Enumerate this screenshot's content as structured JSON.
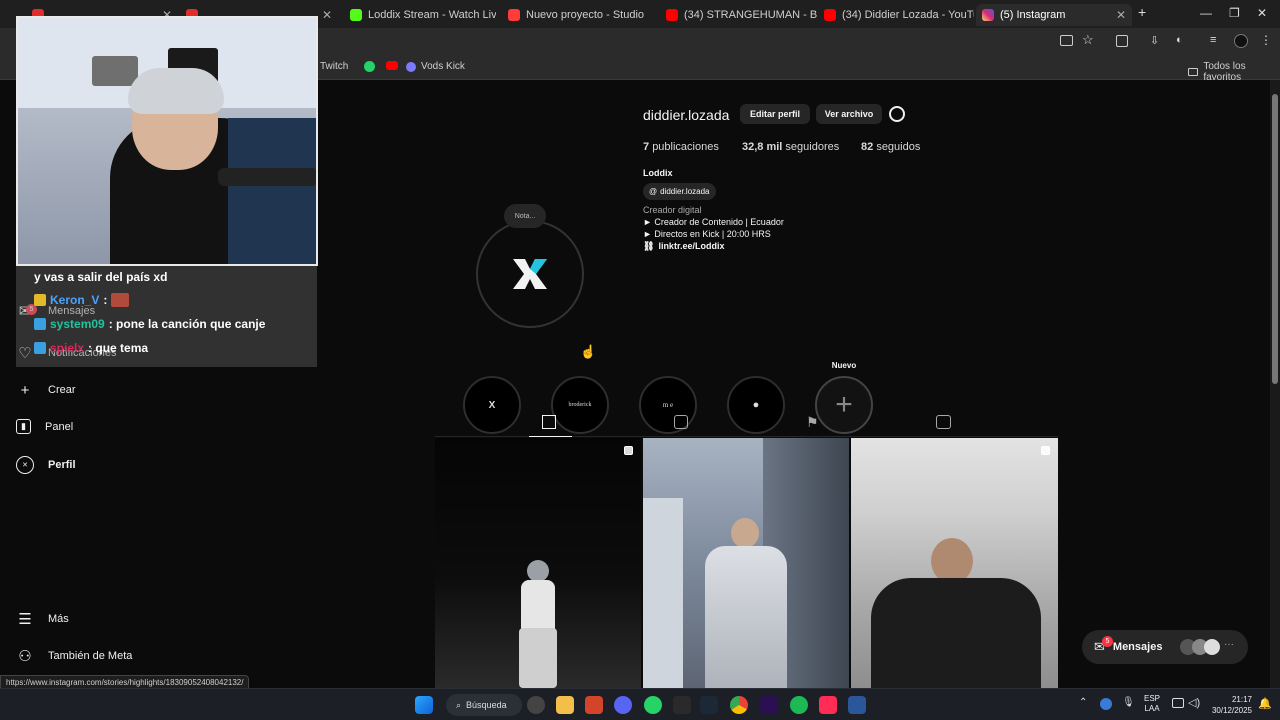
{
  "tabs": [
    {
      "label": "",
      "favicon_color": "#e22b2b",
      "active": false
    },
    {
      "label": "",
      "favicon_color": "#e22b2b",
      "active": false
    },
    {
      "label": "Loddix Stream - Watch Live on",
      "favicon_color": "#53fc18",
      "active": false
    },
    {
      "label": "Nuevo proyecto - Studio",
      "favicon_color": "#ff3b3b",
      "active": false
    },
    {
      "label": "",
      "favicon_color": "#ff5a4e",
      "active": false
    },
    {
      "label": "(34) STRANGEHUMAN - BETTY",
      "favicon_color": "#ff0000",
      "active": false
    },
    {
      "label": "(34) Diddier Lozada - YouTube",
      "favicon_color": "#ff0000",
      "active": false
    },
    {
      "label": "(5) Instagram",
      "favicon_color": "#d6249f",
      "active": true
    }
  ],
  "bookmarks": [
    {
      "label": "Twitch",
      "color": "#9146ff"
    },
    {
      "label": "",
      "color": "#25d366"
    },
    {
      "label": "",
      "color": "#ff0000"
    },
    {
      "label": "Vods Kick",
      "color": "#7b7bff"
    }
  ],
  "bookmarks_folder": "Todos los favoritos",
  "sidebar": {
    "items": [
      {
        "label": "Crear",
        "icon": "plus-icon"
      },
      {
        "label": "Panel",
        "icon": "chart-icon"
      },
      {
        "label": "Perfil",
        "icon": "avatar-icon"
      },
      {
        "label": "Más",
        "icon": "menu-icon"
      },
      {
        "label": "También de Meta",
        "icon": "meta-icon"
      }
    ],
    "mensajes": "Mensajes",
    "mensajes_badge": "5",
    "notificaciones": "Notificaciones"
  },
  "profile": {
    "username": "diddier.lozada",
    "edit_button": "Editar perfil",
    "archive_button": "Ver archivo",
    "posts_count": "7",
    "posts_label": "publicaciones",
    "followers_count": "32,8 mil",
    "followers_label": "seguidores",
    "following_count": "82",
    "following_label": "seguidos",
    "name": "Loddix",
    "threads_handle": "diddier.lozada",
    "category": "Creador digital",
    "bio_line1": "► Creador de Contenido | Ecuador",
    "bio_line2": "► Directos en Kick | 20:00 HRS",
    "link": "linktr.ee/Loddix",
    "note": "Nota..."
  },
  "highlights": [
    {
      "label": "",
      "text": "X"
    },
    {
      "label": "",
      "text": "broderick"
    },
    {
      "label": "",
      "text": "m e"
    },
    {
      "label": "",
      "text": ""
    },
    {
      "label": "Nuevo",
      "text": "+"
    }
  ],
  "profile_tabs": [
    "grid-icon",
    "reels-icon",
    "saved-icon",
    "tagged-icon"
  ],
  "chat_overlay": [
    {
      "user": "",
      "message": "y vas a salir del país xd",
      "user_color": "#ffffff"
    },
    {
      "user": "Keron_V",
      "message": ":",
      "user_color": "#4aa3ff"
    },
    {
      "user": "system09",
      "message": ": pone la canción que canje",
      "user_color": "#1ec4a0"
    },
    {
      "user": "spielx",
      "message": ": que tema",
      "user_color": "#e0245e"
    }
  ],
  "messages_widget": {
    "label": "Mensajes",
    "badge": "5"
  },
  "status_url": "https://www.instagram.com/stories/highlights/18309052408042132/",
  "taskbar": {
    "search": "Búsqueda",
    "language": "ESP",
    "layout": "LAA",
    "time": "21:17",
    "date": "30/12/2025"
  }
}
